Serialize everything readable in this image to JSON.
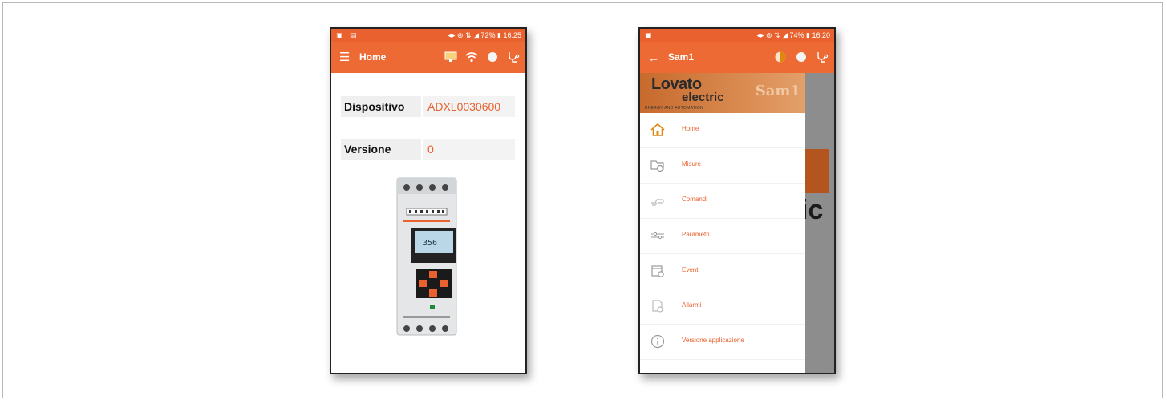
{
  "phone1": {
    "status": {
      "left_icons": "▣ ▤",
      "right_info": "◂▸ ⊚ ⇅ ◢ 72% ▮ 16:25"
    },
    "toolbar": {
      "menu_icon": "hamburger-icon",
      "title": "Home"
    },
    "fields": [
      {
        "label": "Dispositivo",
        "value": "ADXL0030600"
      },
      {
        "label": "Versione",
        "value": "0"
      }
    ]
  },
  "phone2": {
    "status": {
      "left_icons": "▣",
      "right_info": "◂▸ ⊚ ⇅ ◢ 74% ▮ 16:20"
    },
    "toolbar": {
      "back_icon": "back-arrow-icon",
      "title": "Sam1"
    },
    "header": {
      "brand_top": "Lovato",
      "brand_bottom": "electric",
      "tagline": "ENERGY AND AUTOMATION",
      "app_logo": "Sam1"
    },
    "background_text": "ic",
    "menu": [
      {
        "label": "Home",
        "icon": "home-icon"
      },
      {
        "label": "Misure",
        "icon": "measure-folder-icon"
      },
      {
        "label": "Comandi",
        "icon": "command-hand-icon"
      },
      {
        "label": "Parametri",
        "icon": "parameters-icon"
      },
      {
        "label": "Eventi",
        "icon": "events-icon"
      },
      {
        "label": "Allarmi",
        "icon": "alarm-icon"
      },
      {
        "label": "Versione applicazione",
        "icon": "info-icon"
      }
    ]
  },
  "colors": {
    "accent": "#ee6a35",
    "status_bar": "#e8612e",
    "value_text": "#e8612e"
  }
}
